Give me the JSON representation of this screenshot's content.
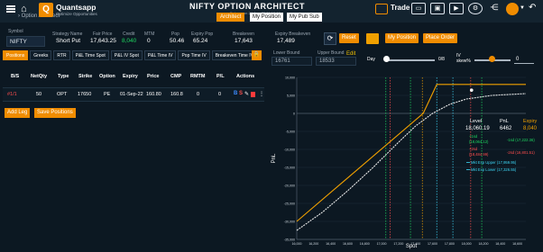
{
  "topbar": {
    "breadcrumb": "Option Architect",
    "logo_letter": "Q",
    "logo_name": "Quantsapp",
    "logo_tagline": "Optimize Opportunities",
    "title": "NIFTY OPTION ARCHITECT",
    "data_as_on": "Data as on 24-Aug-22 21:10:00",
    "tabs": [
      "Architect",
      "My Position",
      "My Pub Sub"
    ],
    "trade_label": "Trade"
  },
  "info": {
    "symbol_label": "Symbol",
    "symbol_value": "NIFTY",
    "fields": [
      {
        "label": "Strategy Name",
        "value": "Short Put"
      },
      {
        "label": "Fair Price",
        "value": "17,643.25"
      },
      {
        "label": "Credit",
        "value": "8,040"
      },
      {
        "label": "MTM",
        "value": "0"
      },
      {
        "label": "Pop",
        "value": "50.46"
      },
      {
        "label": "Expiry Pop",
        "value": "65.24"
      },
      {
        "label": "Breakeven",
        "value": "17,643"
      },
      {
        "label": "Expiry Breakeven",
        "value": "17,489"
      }
    ],
    "buttons": {
      "reset": "Reset",
      "my_position": "My Position",
      "place_order": "Place Order"
    }
  },
  "tabs": [
    "Positions",
    "Greeks",
    "RTR",
    "P&L Time Spot",
    "P&L IV Spot",
    "P&L Time IV",
    "Pop Time IV",
    "Breakeven Time IV"
  ],
  "table": {
    "headers": [
      "B/S",
      "NetQty",
      "Type",
      "Strike",
      "Option",
      "Expiry",
      "Price",
      "CMP",
      "RMTM",
      "P/L",
      "Actions"
    ],
    "rows": [
      {
        "bs": "#1/1",
        "netqty": "50",
        "type": "OPT",
        "strike": "17650",
        "option": "PE",
        "expiry": "01-Sep-22",
        "price": "160.80",
        "cmp": "160.8",
        "rmtm": "0",
        "pl": "0"
      }
    ],
    "add_leg": "Add Leg",
    "save_positions": "Save Positions"
  },
  "controls": {
    "lower_bound_label": "Lower Bound",
    "lower_bound_value": "16761",
    "upper_bound_label": "Upper Bound",
    "upper_bound_value": "18533",
    "edit": "Edit",
    "day_label": "Day",
    "day_value": "0/8",
    "iv_label": "IV",
    "iv_sub": "skew%",
    "iv_value": "0"
  },
  "chart_data": {
    "type": "line",
    "xlabel": "Spot",
    "ylabel": "PnL",
    "xlim": [
      16000,
      18700
    ],
    "ylim": [
      -35000,
      10000
    ],
    "x_ticks": [
      "16,000",
      "16,200",
      "16,400",
      "16,600",
      "16,800",
      "17,000",
      "17,200",
      "17,400",
      "17,600",
      "17,800",
      "18,000",
      "18,200",
      "18,400",
      "18,600"
    ],
    "y_ticks": [
      "10,000",
      "5,000",
      "0",
      "-5,000",
      "-10,000",
      "-15,000",
      "-20,000",
      "-25,000",
      "-30,000",
      "-35,000"
    ],
    "series": [
      {
        "name": "Expiry",
        "color": "#f0a000",
        "x": [
          16000,
          17490,
          17650,
          18700
        ],
        "y": [
          -30000,
          0,
          8040,
          8040
        ]
      },
      {
        "name": "T+0",
        "color": "#e8e8e8",
        "x": [
          16000,
          16300,
          16600,
          16900,
          17200,
          17400,
          17600,
          17800,
          18000,
          18300,
          18700
        ],
        "y": [
          -32500,
          -27500,
          -21500,
          -15000,
          -8000,
          -3500,
          0,
          2500,
          4000,
          5000,
          5500
        ]
      }
    ],
    "vlines": [
      {
        "x": 17050,
        "color": "#1ed760"
      },
      {
        "x": 17100,
        "color": "#ff4d4d"
      },
      {
        "x": 17340,
        "color": "#1ed760"
      },
      {
        "x": 17480,
        "color": "#f0a000"
      },
      {
        "x": 17650,
        "color": "#3dd6f5"
      },
      {
        "x": 17840,
        "color": "#3dd6f5"
      },
      {
        "x": 18050,
        "color": "#ff4d4d"
      },
      {
        "x": 18180,
        "color": "#1ed760"
      }
    ],
    "annotations": {
      "level_label": "Level",
      "level_value": "18,060.19",
      "pnl_label": "PnL",
      "pnl_value": "6462",
      "expiry_label": "Expiry",
      "expiry_value": "8,040",
      "sd1_pos": "+1sd",
      "sd1_pos_val": "(18,064.12)",
      "sd2_pos": "+2sd",
      "sd2_pos_val": "(18,484.99)",
      "sd1_neg": "-1sd (17,222.36)",
      "sd2_neg": "-2sd (16,801.51)",
      "mkt_upper": "Mkt Exp Upper (17,959.95)",
      "mkt_lower": "Mkt Exp Lower (17,326.55)"
    }
  }
}
